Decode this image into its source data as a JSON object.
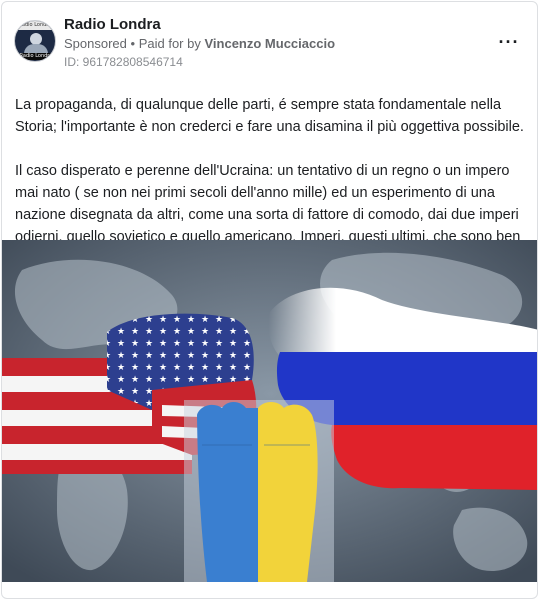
{
  "post": {
    "page_name": "Radio Londra",
    "sponsored": "Sponsored",
    "separator": "•",
    "paid_for_prefix": "Paid for by",
    "paid_for_name": "Vincenzo Mucciaccio",
    "ad_id": "ID: 961782808546714",
    "more_icon": "more-horizontal-icon",
    "more_label": "···",
    "avatar_caption": "Radio Londra",
    "paragraphs": [
      "La propaganda, di qualunque delle parti, é sempre stata fondamentale nella Storia; l'importante è non crederci e fare una disamina il più oggettiva possibile.",
      "Il caso disperato e perenne dell'Ucraina: un tentativo di un regno o un impero mai nato ( se non nei primi secoli dell'anno mille) ed un esperimento di una nazione disegnata da altri, come una sorta di fattore di comodo, dai due imperi odierni, quello sovietico e quello americano. Imperi, questi ultimi, che sono ben distanti d..."
    ]
  },
  "colors": {
    "usa_red": "#c8242d",
    "usa_blue": "#2d3f8f",
    "russia_blue": "#2036c8",
    "russia_red": "#e0222a",
    "ukraine_blue": "#3a7fd0",
    "ukraine_yellow": "#f2d33a"
  }
}
